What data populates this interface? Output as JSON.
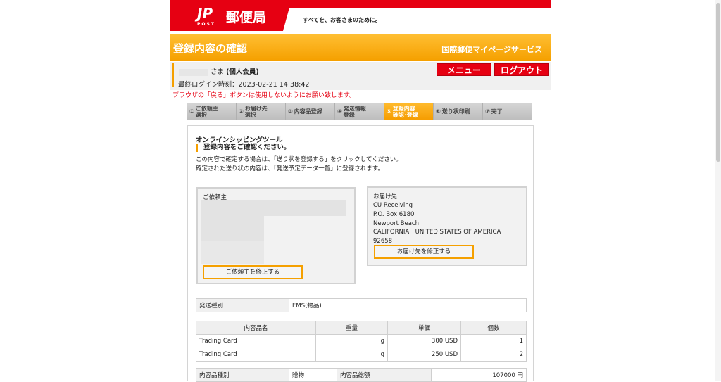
{
  "header": {
    "logo_mark": "JP",
    "logo_post": "POST",
    "logo_name": "郵便局",
    "tagline": "すべてを、お客さまのために。"
  },
  "title_bar": {
    "title": "登録内容の確認",
    "service": "国際郵便マイページサービス"
  },
  "user": {
    "suffix": "さま",
    "member_type": "(個人会員)",
    "last_login_label": "最終ログイン時刻：",
    "last_login_value": "2023-02-21 14:38:42"
  },
  "buttons": {
    "menu": "メニュー",
    "logout": "ログアウト"
  },
  "warning": "ブラウザの「戻る」ボタンは使用しないようにお願い致します。",
  "steps": [
    {
      "num": "①",
      "label": "ご依頼主\n選択"
    },
    {
      "num": "②",
      "label": "お届け先\n選択"
    },
    {
      "num": "③",
      "label": "内容品登録"
    },
    {
      "num": "④",
      "label": "発送情報\n登録"
    },
    {
      "num": "⑤",
      "label": "登録内容\n確認･登録"
    },
    {
      "num": "⑥",
      "label": "送り状印刷"
    },
    {
      "num": "⑦",
      "label": "完了"
    }
  ],
  "active_step": 4,
  "main": {
    "tool_title": "オンラインシッピングツール",
    "confirm_heading": "登録内容をご確認ください。",
    "desc_1": "この内容で確定する場合は、「送り状を登録する」をクリックしてください。",
    "desc_2": "確定された送り状の内容は、「発送予定データ一覧」に登録されます。"
  },
  "sender": {
    "label": "ご依頼主",
    "edit_button": "ご依頼主を修正する"
  },
  "recipient": {
    "label": "お届け先",
    "name": "CU Receiving",
    "line1": "P.O. Box 6180",
    "city": "Newport Beach",
    "state_country": "CALIFORNIA　UNITED STATES OF AMERICA",
    "zip": "92658",
    "edit_button": "お届け先を修正する"
  },
  "shipping": {
    "label": "発送種別",
    "value": "EMS(物品)"
  },
  "items_table": {
    "headers": [
      "内容品名",
      "重量",
      "単価",
      "個数"
    ],
    "rows": [
      {
        "name": "Trading Card",
        "weight_unit": "g",
        "price": "300 USD",
        "qty": "1"
      },
      {
        "name": "Trading Card",
        "weight_unit": "g",
        "price": "250 USD",
        "qty": "2"
      }
    ]
  },
  "totals": {
    "type_label": "内容品種別",
    "type_value": "贈物",
    "total_label": "内容品総額",
    "total_value": "107000 円"
  }
}
